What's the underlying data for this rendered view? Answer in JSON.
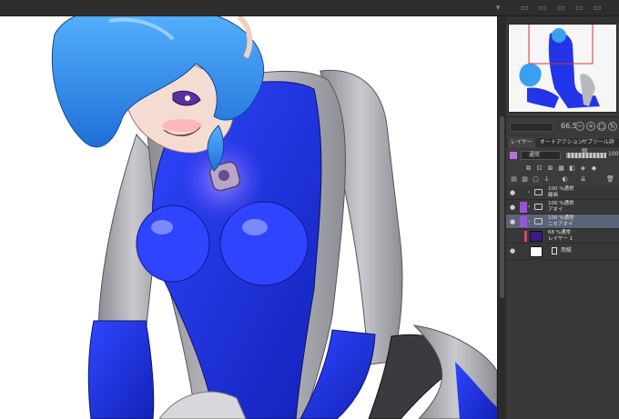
{
  "navigator": {
    "zoom": "66.5"
  },
  "layer_panel": {
    "tabs": [
      "レイヤー",
      "オートアクション",
      "サブツール詳細"
    ],
    "blend_mode": "通常",
    "opacity": "100"
  },
  "layers": [
    {
      "mode": "100 %通常",
      "name": "線画",
      "type": "folder"
    },
    {
      "mode": "100 %通常",
      "name": "アオイ",
      "type": "folder"
    },
    {
      "mode": "100 %通常",
      "name": "ニセアオイ",
      "type": "folder",
      "selected": true
    },
    {
      "mode": "68 %通常",
      "name": "レイヤー 1",
      "type": "raster",
      "thumb_color": "#3a1a8a"
    },
    {
      "name": "用紙",
      "type": "paper"
    }
  ],
  "colors": {
    "suit_blue": "#1a2fe0",
    "suit_gray": "#a8a8ae",
    "hair_blue": "#3aa0f0",
    "selection": "#5a6478",
    "accent_purple": "#b472e0"
  }
}
